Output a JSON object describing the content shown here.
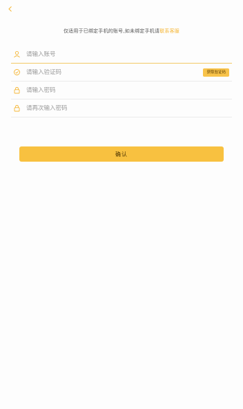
{
  "nav": {
    "back_icon": "chevron-left-icon"
  },
  "notice": {
    "text": "仅适用于已绑定手机的账号,如未绑定手机请",
    "link": "联系客服"
  },
  "form": {
    "account": {
      "placeholder": "请输入账号",
      "icon": "user-icon"
    },
    "code": {
      "placeholder": "请输入验证码",
      "icon": "shield-icon",
      "button": "获取验证码"
    },
    "password": {
      "placeholder": "请输入密码",
      "icon": "lock-icon"
    },
    "password_confirm": {
      "placeholder": "请再次输入密码",
      "icon": "lock-icon"
    }
  },
  "confirm_label": "确认",
  "colors": {
    "accent": "#f8c140",
    "link": "#f5b532"
  }
}
